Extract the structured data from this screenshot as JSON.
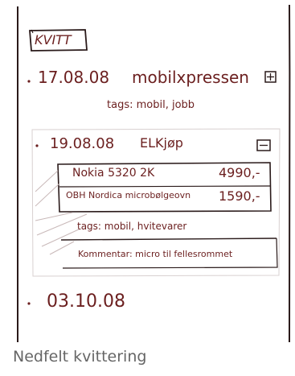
{
  "app_title": "KVITT",
  "receipts": [
    {
      "date": "17.08.08",
      "store": "mobilxpressen",
      "toggle_icon": "plus-box-icon",
      "tags_text": "tags: mobil, jobb"
    },
    {
      "date": "19.08.08",
      "store": "ELKjøp",
      "toggle_icon": "minus-box-icon",
      "items": [
        {
          "name": "Nokia 5320 2K",
          "price": "4990,-"
        },
        {
          "name": "OBH Nordica microbølgeovn",
          "price": "1590,-"
        }
      ],
      "tags_text": "tags: mobil, hvitevarer",
      "comment_text": "Kommentar: micro til fellesrommet"
    },
    {
      "date": "03.10.08",
      "store": ""
    }
  ],
  "caption": "Nedfelt kvittering",
  "colors": {
    "ink": "#6b1f1f",
    "caption": "#666666",
    "frame": "#2a1a1a"
  }
}
